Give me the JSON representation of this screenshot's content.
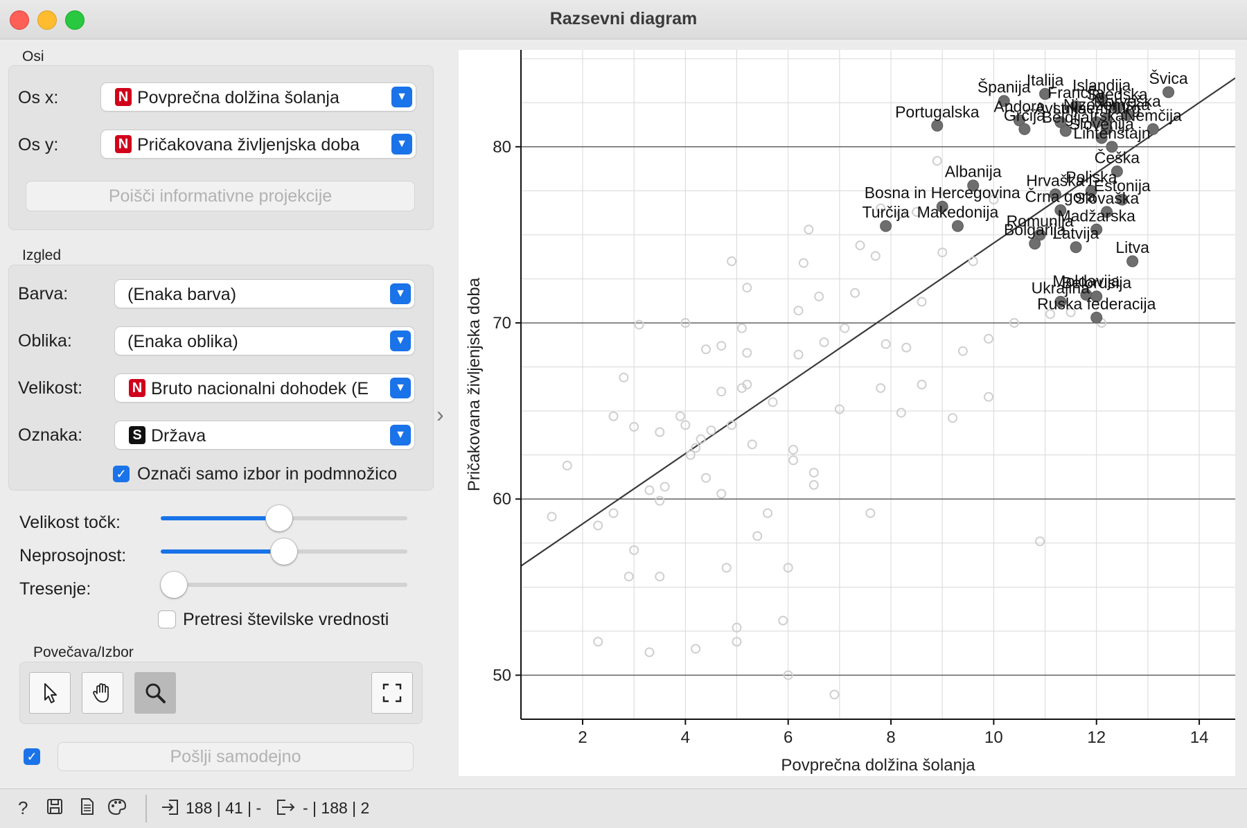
{
  "window": {
    "title": "Razsevni diagram"
  },
  "axes_box": {
    "section": "Osi",
    "x_label": "Os x:",
    "x_value": "Povprečna dolžina šolanja",
    "x_badge": "N",
    "y_label": "Os y:",
    "y_value": "Pričakovana življenjska doba",
    "y_badge": "N",
    "find_button": "Poišči informativne projekcije"
  },
  "appearance": {
    "section": "Izgled",
    "color_label": "Barva:",
    "color_value": "(Enaka barva)",
    "shape_label": "Oblika:",
    "shape_value": "(Enaka oblika)",
    "size_label": "Velikost:",
    "size_value": "Bruto nacionalni dohodek (E",
    "size_badge": "N",
    "label_label": "Oznaka:",
    "label_value": "Država",
    "label_badge": "S",
    "label_only_selected": "Označi samo izbor in podmnožico",
    "label_only_selected_checked": true
  },
  "sliders": {
    "point_size_label": "Velikost točk:",
    "point_size_value": 0.48,
    "opacity_label": "Neprosojnost:",
    "opacity_value": 0.5,
    "jitter_label": "Tresenje:",
    "jitter_value": 0.0,
    "jitter_numeric_label": "Pretresi številske vrednosti",
    "jitter_numeric_checked": false
  },
  "zoom": {
    "section": "Povečava/Izbor",
    "tools": [
      "pointer-icon",
      "hand-icon",
      "magnifier-icon",
      "fit-view-icon"
    ]
  },
  "send": {
    "auto_label": "Pošlji samodejno",
    "auto_checked": true
  },
  "status": {
    "input": "188 | 41 | -",
    "output": "- | 188 | 2"
  },
  "colors": {
    "accent": "#1a73e8",
    "badge_numeric": "#d0021b",
    "badge_string": "#111111"
  },
  "chart_data": {
    "type": "scatter",
    "xlabel": "Povprečna dolžina šolanja",
    "ylabel": "Pričakovana življenjska doba",
    "xlim": [
      0.8,
      14.7
    ],
    "ylim": [
      47.5,
      85.5
    ],
    "xticks": [
      2,
      4,
      6,
      8,
      10,
      12,
      14
    ],
    "yticks": [
      50,
      60,
      70,
      80
    ],
    "grid": true,
    "regression_line": {
      "x": [
        0.8,
        14.7
      ],
      "y": [
        56.2,
        83.9
      ]
    },
    "labeled_points": [
      {
        "label": "Švica",
        "x": 13.4,
        "y": 83.1
      },
      {
        "label": "Italija",
        "x": 11.0,
        "y": 83.0
      },
      {
        "label": "Španija",
        "x": 10.2,
        "y": 82.6
      },
      {
        "label": "Islandija",
        "x": 12.1,
        "y": 82.7
      },
      {
        "label": "Francija",
        "x": 11.6,
        "y": 82.3
      },
      {
        "label": "Švedska",
        "x": 12.4,
        "y": 82.2
      },
      {
        "label": "Norveška",
        "x": 12.6,
        "y": 81.8
      },
      {
        "label": "Andora",
        "x": 10.5,
        "y": 81.5
      },
      {
        "label": "Avstrija",
        "x": 11.3,
        "y": 81.4
      },
      {
        "label": "Nizozemska",
        "x": 12.2,
        "y": 81.6
      },
      {
        "label": "Portugalska",
        "x": 8.9,
        "y": 81.2
      },
      {
        "label": "Grčija",
        "x": 10.6,
        "y": 81.0
      },
      {
        "label": "Belgija",
        "x": 11.4,
        "y": 80.9
      },
      {
        "label": "Irska",
        "x": 12.2,
        "y": 81.0
      },
      {
        "label": "Nemčija",
        "x": 13.1,
        "y": 81.0
      },
      {
        "label": "Slovenija",
        "x": 12.1,
        "y": 80.5
      },
      {
        "label": "Luksemburg",
        "x": 12.0,
        "y": 81.4
      },
      {
        "label": "Lihtenštajn",
        "x": 12.3,
        "y": 80.0
      },
      {
        "label": "Češka",
        "x": 12.4,
        "y": 78.6
      },
      {
        "label": "Albanija",
        "x": 9.6,
        "y": 77.8
      },
      {
        "label": "Hrvaška",
        "x": 11.2,
        "y": 77.3
      },
      {
        "label": "Poljska",
        "x": 11.9,
        "y": 77.5
      },
      {
        "label": "Estonija",
        "x": 12.5,
        "y": 77.0
      },
      {
        "label": "Bosna in Hercegovina",
        "x": 9.0,
        "y": 76.6
      },
      {
        "label": "Črna gora",
        "x": 11.3,
        "y": 76.4
      },
      {
        "label": "Slovaška",
        "x": 12.2,
        "y": 76.3
      },
      {
        "label": "Turčija",
        "x": 7.9,
        "y": 75.5
      },
      {
        "label": "Makedonija",
        "x": 9.3,
        "y": 75.5
      },
      {
        "label": "Madžarska",
        "x": 12.0,
        "y": 75.3
      },
      {
        "label": "Romunija",
        "x": 10.9,
        "y": 75.0
      },
      {
        "label": "Bolgarija",
        "x": 10.8,
        "y": 74.5
      },
      {
        "label": "Latvija",
        "x": 11.6,
        "y": 74.3
      },
      {
        "label": "Litva",
        "x": 12.7,
        "y": 73.5
      },
      {
        "label": "Moldavija",
        "x": 11.8,
        "y": 71.6
      },
      {
        "label": "Belorusija",
        "x": 12.0,
        "y": 71.5
      },
      {
        "label": "Ukrajina",
        "x": 11.3,
        "y": 71.2
      },
      {
        "label": "Ruska federacija",
        "x": 12.0,
        "y": 70.3
      }
    ],
    "unlabeled_points": [
      {
        "x": 1.4,
        "y": 59.0
      },
      {
        "x": 1.7,
        "y": 61.9
      },
      {
        "x": 2.3,
        "y": 51.9
      },
      {
        "x": 2.3,
        "y": 58.5
      },
      {
        "x": 2.6,
        "y": 59.2
      },
      {
        "x": 2.6,
        "y": 64.7
      },
      {
        "x": 2.8,
        "y": 66.9
      },
      {
        "x": 2.9,
        "y": 55.6
      },
      {
        "x": 3.0,
        "y": 64.1
      },
      {
        "x": 3.0,
        "y": 57.1
      },
      {
        "x": 3.1,
        "y": 69.9
      },
      {
        "x": 3.3,
        "y": 51.3
      },
      {
        "x": 3.3,
        "y": 60.5
      },
      {
        "x": 3.5,
        "y": 63.8
      },
      {
        "x": 3.5,
        "y": 59.9
      },
      {
        "x": 3.5,
        "y": 55.6
      },
      {
        "x": 3.6,
        "y": 60.7
      },
      {
        "x": 3.9,
        "y": 64.7
      },
      {
        "x": 4.0,
        "y": 64.2
      },
      {
        "x": 4.0,
        "y": 70.0
      },
      {
        "x": 4.1,
        "y": 62.5
      },
      {
        "x": 4.2,
        "y": 51.5
      },
      {
        "x": 4.2,
        "y": 62.9
      },
      {
        "x": 4.3,
        "y": 63.4
      },
      {
        "x": 4.4,
        "y": 61.2
      },
      {
        "x": 4.4,
        "y": 68.5
      },
      {
        "x": 4.5,
        "y": 63.9
      },
      {
        "x": 4.7,
        "y": 66.1
      },
      {
        "x": 4.7,
        "y": 68.7
      },
      {
        "x": 4.7,
        "y": 60.3
      },
      {
        "x": 4.8,
        "y": 56.1
      },
      {
        "x": 4.9,
        "y": 64.2
      },
      {
        "x": 4.9,
        "y": 73.5
      },
      {
        "x": 5.0,
        "y": 51.9
      },
      {
        "x": 5.0,
        "y": 52.7
      },
      {
        "x": 5.1,
        "y": 66.3
      },
      {
        "x": 5.1,
        "y": 69.7
      },
      {
        "x": 5.2,
        "y": 66.5
      },
      {
        "x": 5.2,
        "y": 68.3
      },
      {
        "x": 5.2,
        "y": 72.0
      },
      {
        "x": 5.3,
        "y": 63.1
      },
      {
        "x": 5.4,
        "y": 57.9
      },
      {
        "x": 5.6,
        "y": 59.2
      },
      {
        "x": 5.7,
        "y": 65.5
      },
      {
        "x": 5.9,
        "y": 53.1
      },
      {
        "x": 6.0,
        "y": 50.0
      },
      {
        "x": 6.0,
        "y": 56.1
      },
      {
        "x": 6.1,
        "y": 62.8
      },
      {
        "x": 6.1,
        "y": 62.2
      },
      {
        "x": 6.2,
        "y": 68.2
      },
      {
        "x": 6.2,
        "y": 70.7
      },
      {
        "x": 6.3,
        "y": 73.4
      },
      {
        "x": 6.4,
        "y": 75.3
      },
      {
        "x": 6.5,
        "y": 61.5
      },
      {
        "x": 6.5,
        "y": 60.8
      },
      {
        "x": 6.6,
        "y": 71.5
      },
      {
        "x": 6.7,
        "y": 68.9
      },
      {
        "x": 6.9,
        "y": 48.9
      },
      {
        "x": 7.0,
        "y": 65.1
      },
      {
        "x": 7.1,
        "y": 69.7
      },
      {
        "x": 7.3,
        "y": 71.7
      },
      {
        "x": 7.4,
        "y": 74.4
      },
      {
        "x": 7.6,
        "y": 59.2
      },
      {
        "x": 7.7,
        "y": 73.8
      },
      {
        "x": 7.8,
        "y": 66.3
      },
      {
        "x": 7.8,
        "y": 76.5
      },
      {
        "x": 7.9,
        "y": 68.8
      },
      {
        "x": 8.2,
        "y": 64.9
      },
      {
        "x": 8.2,
        "y": 76.2
      },
      {
        "x": 8.3,
        "y": 68.6
      },
      {
        "x": 8.5,
        "y": 76.3
      },
      {
        "x": 8.6,
        "y": 71.2
      },
      {
        "x": 8.6,
        "y": 66.5
      },
      {
        "x": 8.9,
        "y": 79.2
      },
      {
        "x": 9.0,
        "y": 74.0
      },
      {
        "x": 9.2,
        "y": 64.6
      },
      {
        "x": 9.4,
        "y": 68.4
      },
      {
        "x": 9.6,
        "y": 73.5
      },
      {
        "x": 9.9,
        "y": 65.8
      },
      {
        "x": 9.9,
        "y": 69.1
      },
      {
        "x": 10.0,
        "y": 77.0
      },
      {
        "x": 10.4,
        "y": 70.0
      },
      {
        "x": 10.9,
        "y": 57.6
      },
      {
        "x": 11.1,
        "y": 70.5
      },
      {
        "x": 11.5,
        "y": 70.6
      },
      {
        "x": 12.1,
        "y": 70.0
      }
    ]
  }
}
